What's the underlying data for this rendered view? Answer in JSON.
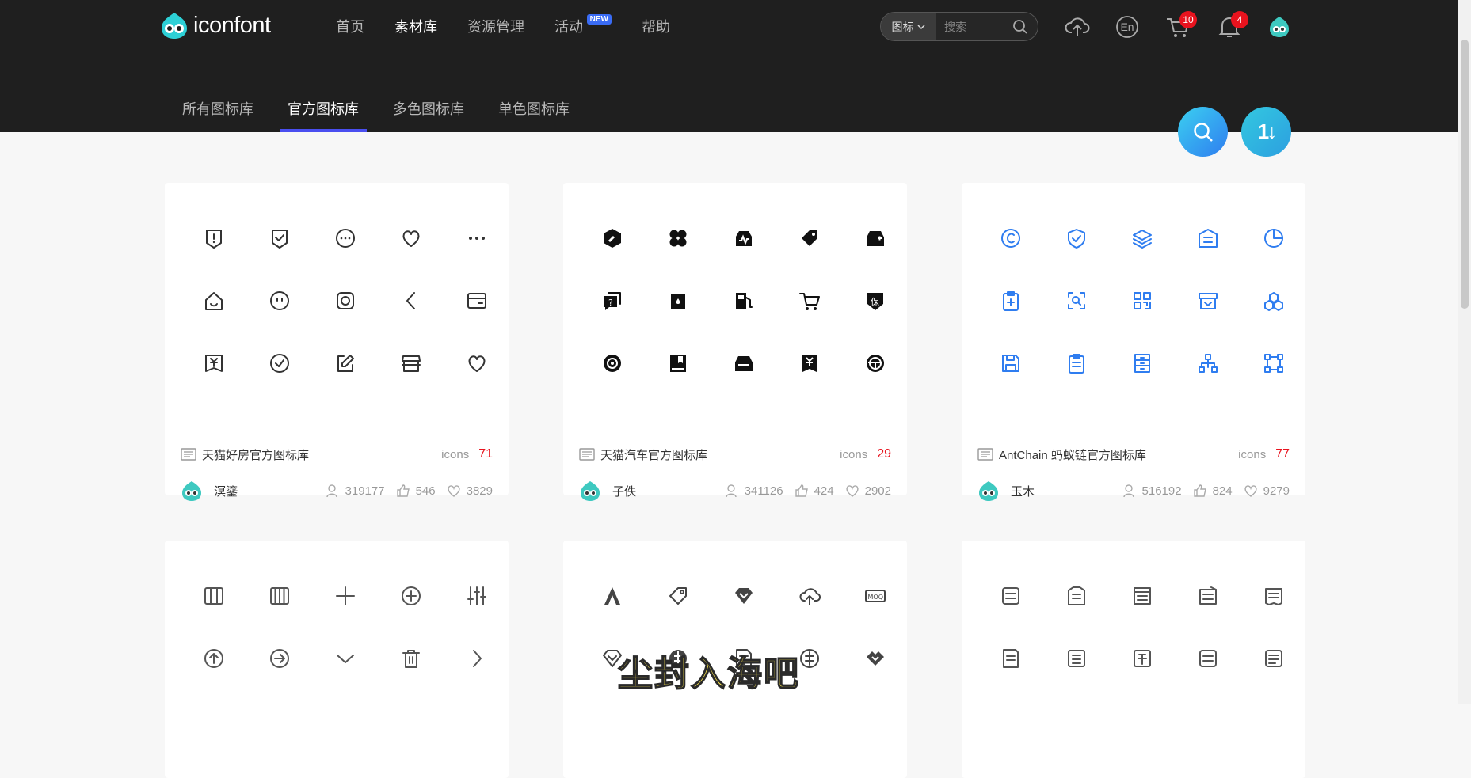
{
  "header": {
    "logo_text": "iconfont",
    "menu": [
      {
        "label": "首页",
        "active": false
      },
      {
        "label": "素材库",
        "active": true
      },
      {
        "label": "资源管理",
        "active": false
      },
      {
        "label": "活动",
        "active": false,
        "badge": "NEW"
      },
      {
        "label": "帮助",
        "active": false
      }
    ],
    "search": {
      "type_label": "图标",
      "placeholder": "搜索"
    },
    "tools": {
      "upload_icon": "cloud-upload-icon",
      "language_label": "En",
      "cart_count": "10",
      "notification_count": "4"
    }
  },
  "subtabs": [
    {
      "label": "所有图标库",
      "active": false
    },
    {
      "label": "官方图标库",
      "active": true
    },
    {
      "label": "多色图标库",
      "active": false
    },
    {
      "label": "单色图标库",
      "active": false
    }
  ],
  "fabs": {
    "sort_label": "1↓"
  },
  "cards": [
    {
      "title": "天猫好房官方图标库",
      "icons_label": "icons",
      "icons_count": "71",
      "author": "溟鎏",
      "views": "319177",
      "likes": "546",
      "favorites": "3829",
      "icon_color": "#333333",
      "icons": [
        "alert-shield-icon",
        "check-shield-icon",
        "chat-bubble-icon",
        "heart-icon",
        "more-dots-icon",
        "house-smile-icon",
        "smile-face-icon",
        "rounded-square-icon",
        "chevron-left-icon",
        "card-icon",
        "yuan-receipt-icon",
        "check-circle-icon",
        "edit-note-icon",
        "store-icon",
        "heart-outline-icon"
      ]
    },
    {
      "title": "天猫汽车官方图标库",
      "icons_label": "icons",
      "icons_count": "29",
      "author": "子佚",
      "views": "341126",
      "likes": "424",
      "favorites": "2902",
      "icon_color": "#111111",
      "icons": [
        "wrench-badge-icon",
        "clover-icon",
        "car-pulse-icon",
        "tag-edit-icon",
        "car-plus-icon",
        "question-chat-icon",
        "oil-can-icon",
        "fuel-pump-icon",
        "cart-icon",
        "insurance-shield-icon",
        "wheel-icon",
        "manual-book-icon",
        "car-front-icon",
        "yuan-bill-icon",
        "steering-wheel-icon"
      ]
    },
    {
      "title": "AntChain 蚂蚁链官方图标库",
      "icons_label": "icons",
      "icons_count": "77",
      "author": "玉木",
      "views": "516192",
      "likes": "824",
      "favorites": "9279",
      "icon_color": "#2f7df0",
      "icons": [
        "copyright-icon",
        "shield-check-icon",
        "layers-icon",
        "bank-icon",
        "pie-chart-icon",
        "clipboard-plus-icon",
        "scan-search-icon",
        "qr-code-icon",
        "archive-icon",
        "nodes-icon",
        "save-disk-icon",
        "clipboard-list-icon",
        "server-icon",
        "org-tree-icon",
        "vector-frame-icon"
      ]
    },
    {
      "icon_color": "#555555",
      "icons": [
        "columns-3-icon",
        "columns-4-icon",
        "plus-icon",
        "plus-circle-icon",
        "sliders-icon",
        "arrow-up-circle-icon",
        "arrow-right-circle-icon",
        "chevron-down-icon",
        "trash-icon",
        "chevron-right-icon"
      ]
    },
    {
      "icon_color": "#444444",
      "icons": [
        "font-a-icon",
        "price-tag-icon",
        "diamond-icon",
        "cloud-upload-icon",
        "moq-icon",
        "diamond-outline-icon",
        "equal-circle-icon",
        "document-icon",
        "equal-circle-outline-icon",
        "handshake-icon"
      ]
    },
    {
      "icon_color": "#555555",
      "icons": [
        "stamp-icon",
        "shirt-label-icon",
        "document-box-icon",
        "sign-box-icon",
        "fabric-label-icon",
        "receipt-label-icon",
        "water-label-icon",
        "thousand-icon",
        "other-label-icon",
        "crease-label-icon"
      ]
    }
  ],
  "watermark": "尘封入海吧"
}
